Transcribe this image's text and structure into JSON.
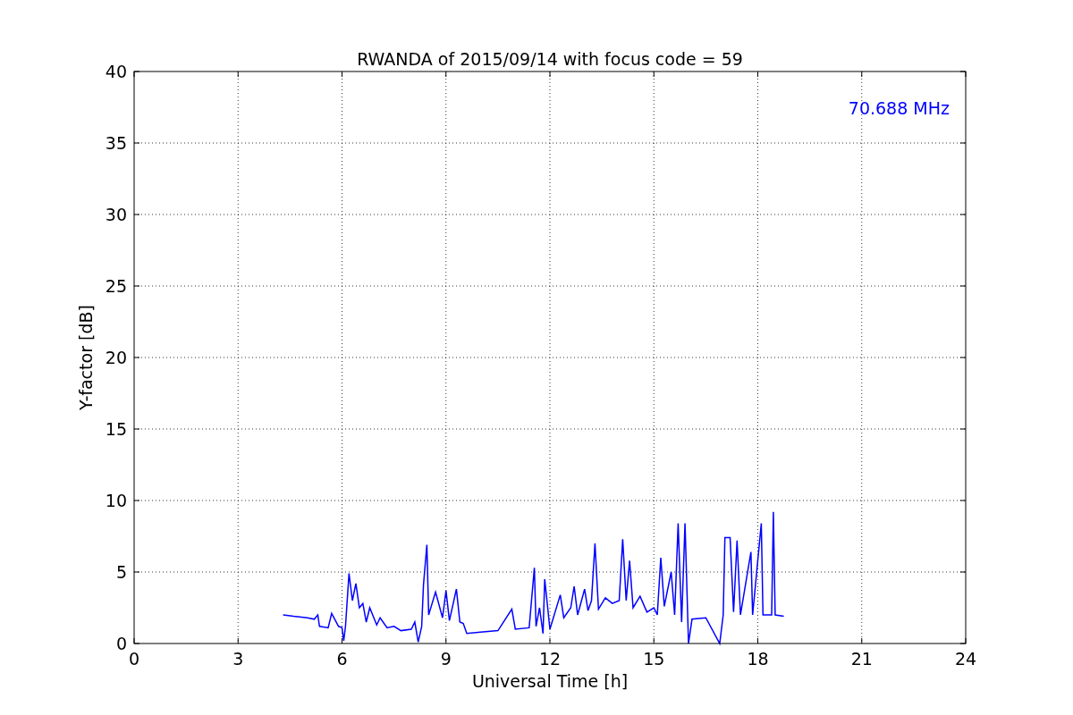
{
  "chart_data": {
    "type": "line",
    "title": "RWANDA of 2015/09/14 with focus code = 59",
    "xlabel": "Universal Time [h]",
    "ylabel": "Y-factor [dB]",
    "x": [
      4.3,
      4.6,
      5.0,
      5.2,
      5.3,
      5.35,
      5.6,
      5.7,
      5.9,
      6.0,
      6.05,
      6.1,
      6.2,
      6.3,
      6.4,
      6.5,
      6.6,
      6.7,
      6.8,
      7.0,
      7.1,
      7.3,
      7.5,
      7.7,
      8.0,
      8.1,
      8.2,
      8.3,
      8.35,
      8.45,
      8.5,
      8.7,
      8.9,
      9.0,
      9.1,
      9.3,
      9.4,
      9.5,
      9.6,
      10.0,
      10.5,
      10.9,
      11.0,
      11.4,
      11.55,
      11.6,
      11.7,
      11.8,
      11.85,
      12.0,
      12.3,
      12.4,
      12.6,
      12.7,
      12.8,
      13.0,
      13.1,
      13.2,
      13.3,
      13.4,
      13.6,
      13.8,
      14.0,
      14.1,
      14.2,
      14.3,
      14.4,
      14.6,
      14.8,
      15.0,
      15.1,
      15.2,
      15.3,
      15.5,
      15.6,
      15.7,
      15.8,
      15.9,
      16.0,
      16.1,
      16.5,
      16.9,
      17.0,
      17.05,
      17.2,
      17.3,
      17.4,
      17.5,
      17.8,
      17.85,
      18.1,
      18.15,
      18.4,
      18.45,
      18.5,
      18.75
    ],
    "series": [
      {
        "name": "70.688 MHz",
        "color": "#0000ff",
        "values": [
          2.0,
          1.9,
          1.8,
          1.7,
          2.0,
          1.2,
          1.1,
          2.1,
          1.2,
          1.1,
          0.2,
          1.2,
          4.9,
          3.0,
          4.2,
          2.5,
          2.8,
          1.5,
          2.5,
          1.3,
          1.8,
          1.1,
          1.2,
          0.9,
          1.0,
          1.5,
          0.1,
          1.2,
          4.1,
          6.9,
          2.0,
          3.6,
          1.8,
          3.7,
          1.6,
          3.8,
          1.5,
          1.4,
          0.7,
          0.8,
          0.9,
          2.4,
          1.0,
          1.1,
          5.3,
          1.2,
          2.5,
          0.7,
          4.5,
          1.0,
          3.4,
          1.8,
          2.5,
          4.0,
          2.0,
          3.8,
          2.3,
          3.0,
          7.0,
          2.4,
          3.2,
          2.8,
          3.0,
          7.3,
          3.0,
          5.8,
          2.5,
          3.3,
          2.2,
          2.5,
          2.0,
          6.0,
          2.6,
          5.0,
          2.0,
          8.4,
          1.5,
          8.4,
          0.0,
          1.7,
          1.8,
          0.0,
          2.0,
          7.4,
          7.4,
          2.2,
          7.2,
          2.0,
          6.4,
          2.0,
          8.4,
          2.0,
          2.0,
          9.2,
          2.0,
          1.9
        ]
      }
    ],
    "xlim": [
      0,
      24
    ],
    "ylim": [
      0,
      40
    ],
    "xticks": [
      0,
      3,
      6,
      9,
      12,
      15,
      18,
      21,
      24
    ],
    "yticks": [
      0,
      5,
      10,
      15,
      20,
      25,
      30,
      35,
      40
    ],
    "grid": true
  }
}
